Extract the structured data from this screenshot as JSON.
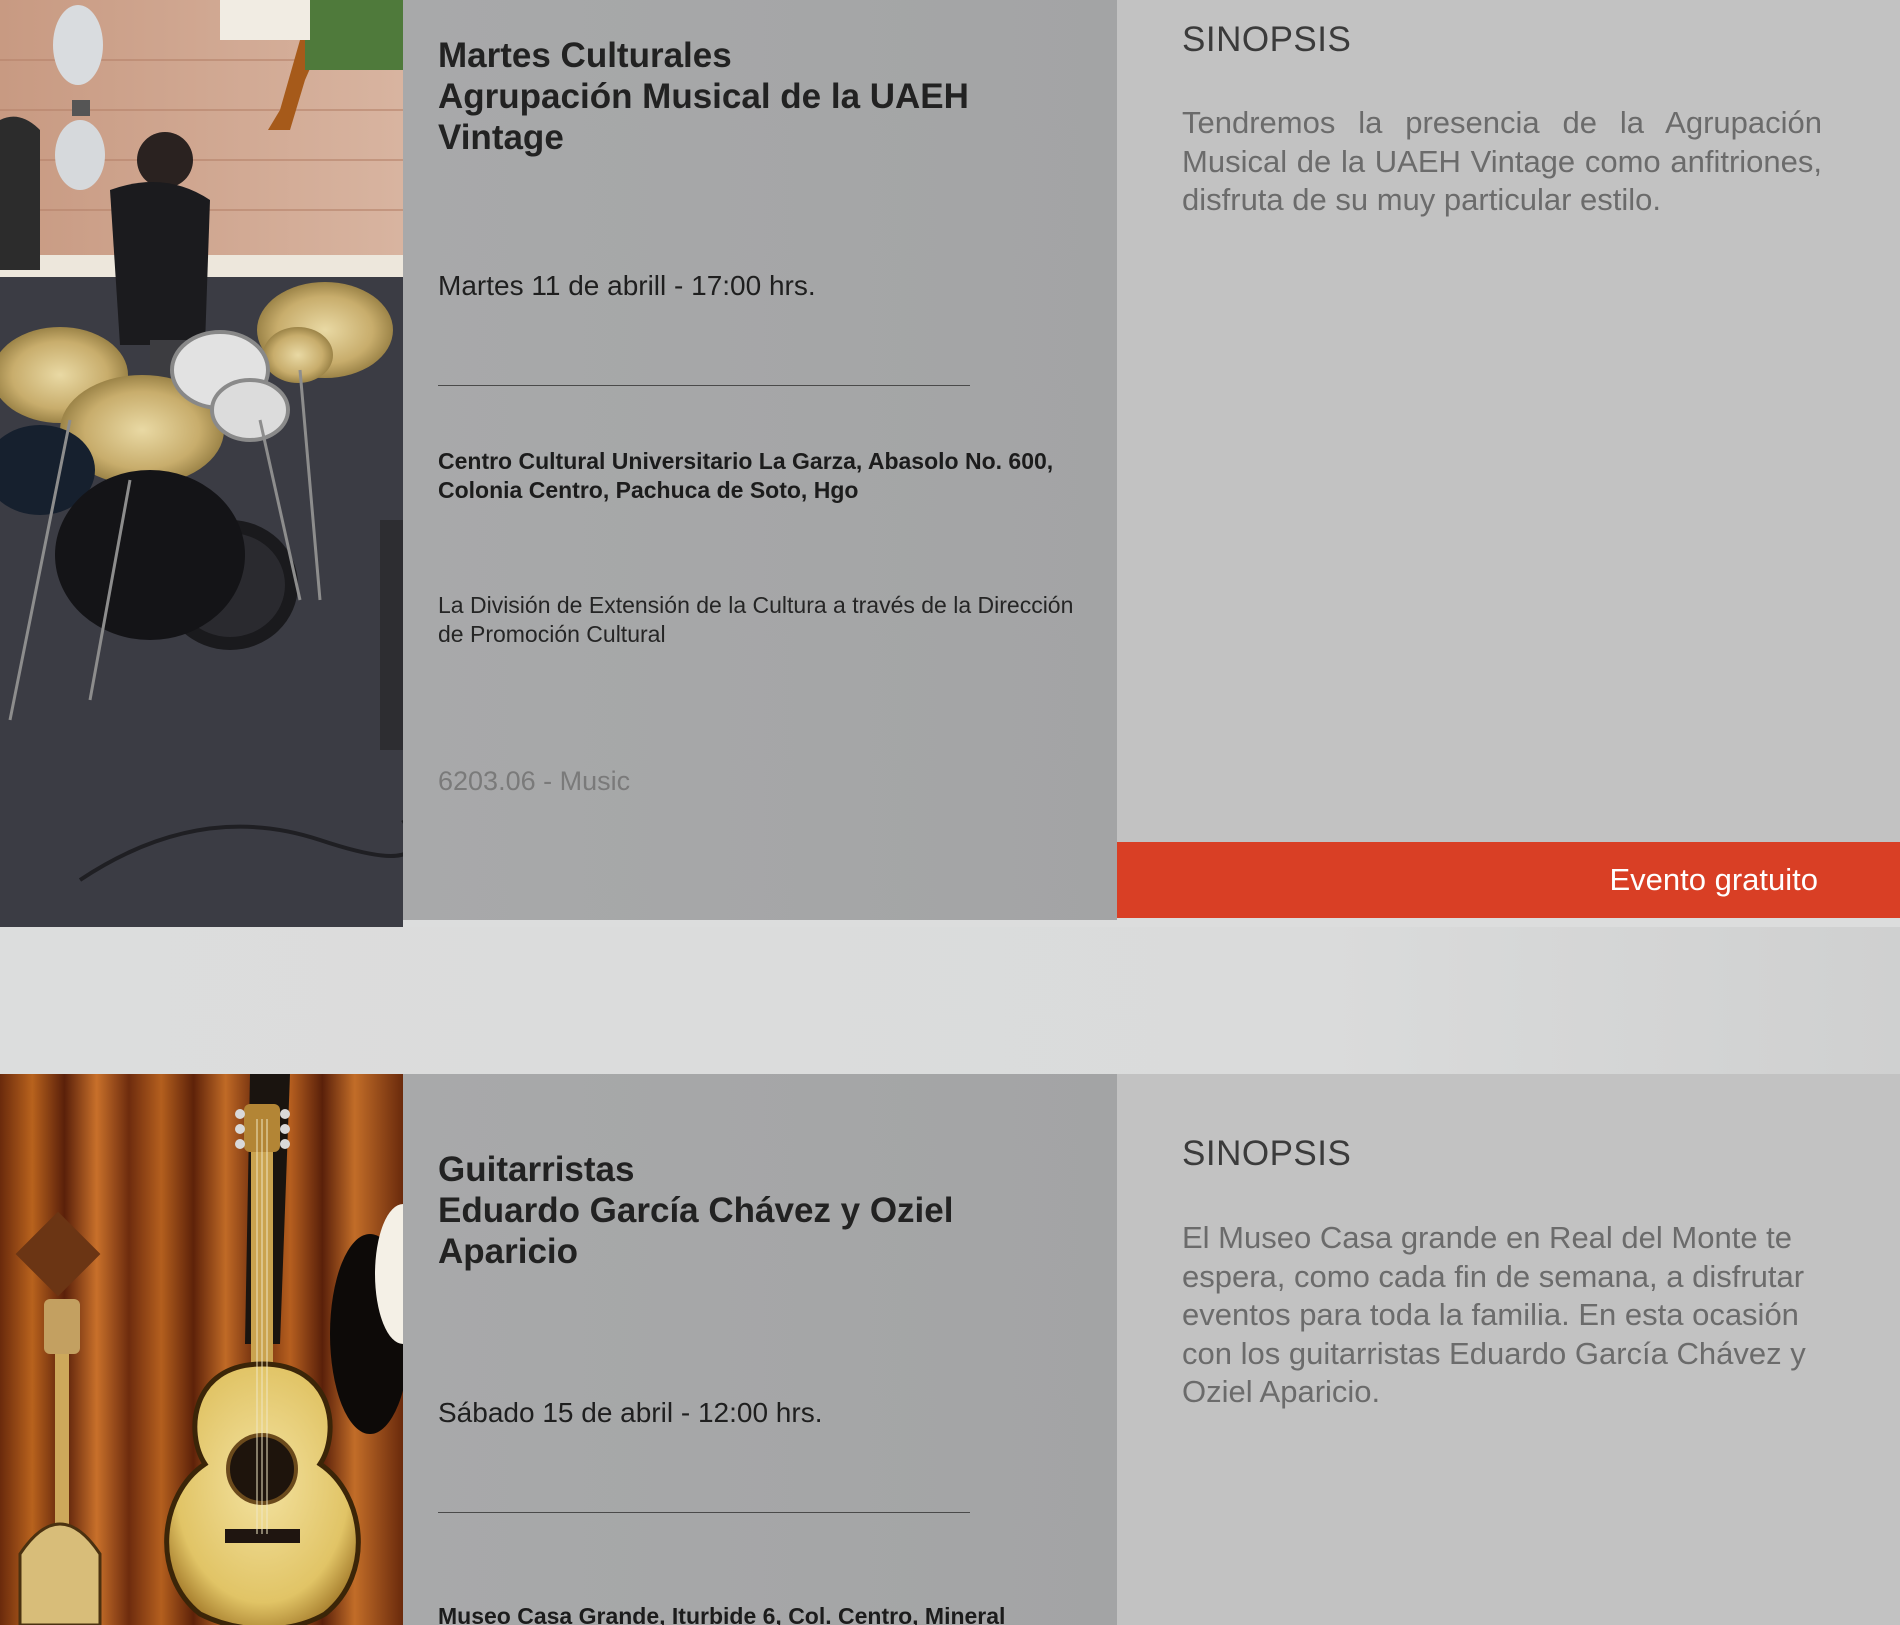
{
  "events": [
    {
      "title_lines": [
        "Martes Culturales",
        "Agrupación Musical de la UAEH",
        "Vintage"
      ],
      "datetime": "Martes 11 de  abrill - 17:00 hrs.",
      "venue": "Centro Cultural Universitario La Garza, Abasolo No. 600, Colonia Centro, Pachuca de Soto, Hgo",
      "organizer": "La División de Extensión de la Cultura a través de la Dirección de Promoción Cultural",
      "category": "6203.06 - Music",
      "synopsis_heading": "SINOPSIS",
      "synopsis": "Tendremos la presencia de la Agrupación Musical de la UAEH Vintage como anfitriones, disfruta de su muy particular estilo.",
      "badge": "Evento gratuito"
    },
    {
      "title_lines": [
        "Guitarristas",
        "Eduardo García Chávez y Oziel",
        "Aparicio"
      ],
      "datetime": "Sábado 15 de abril - 12:00  hrs.",
      "venue": "Museo Casa Grande, Iturbide 6, Col. Centro, Mineral",
      "synopsis_heading": "SINOPSIS",
      "synopsis": "El Museo Casa grande en Real del Monte te espera, como cada fin de semana, a disfrutar eventos para toda la familia. En esta ocasión con los guitarristas Eduardo García Chávez y Oziel Aparicio."
    }
  ],
  "colors": {
    "badge_red": "#d93f25",
    "info_panel": "#a6a7a8",
    "synopsis_panel": "#c2c2c2",
    "page_background": "#dcdddd"
  }
}
